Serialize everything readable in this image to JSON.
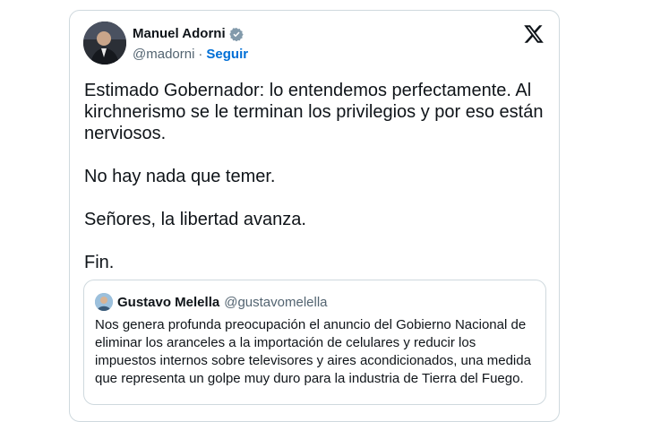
{
  "tweet": {
    "author_name": "Manuel Adorni",
    "author_handle": "@madorni",
    "separator": "·",
    "follow_label": "Seguir",
    "text": "Estimado Gobernador: lo entendemos perfectamente. Al kirchnerismo se le terminan los privilegios y por eso están nerviosos.\n\nNo hay nada que temer.\n\nSeñores, la libertad avanza.\n\nFin."
  },
  "quoted": {
    "author_name": "Gustavo Melella",
    "author_handle": "@gustavomelella",
    "text": "Nos genera profunda preocupación el anuncio del Gobierno Nacional de eliminar los aranceles a la importación de celulares y reducir los impuestos internos sobre televisores y aires acondicionados, una medida que representa un golpe muy duro para la industria de Tierra del Fuego."
  },
  "icons": {
    "verified": "verified-badge-icon",
    "platform": "x-logo-icon"
  },
  "colors": {
    "link_blue": "#006fd6",
    "text": "#0f1419",
    "secondary": "#536471",
    "border": "#cfd9de",
    "verified_gray": "#829aab"
  }
}
